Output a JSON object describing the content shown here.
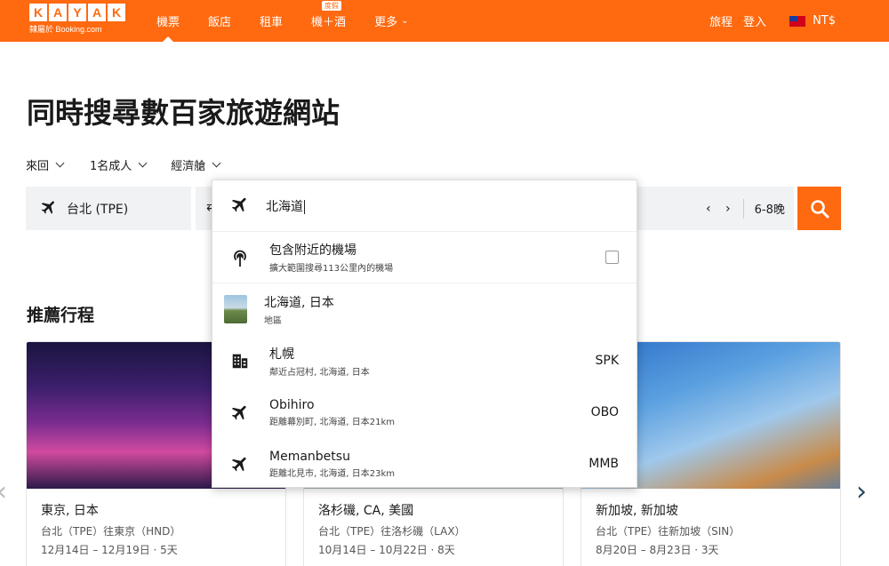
{
  "header": {
    "logo_letters": [
      "K",
      "A",
      "Y",
      "A",
      "K"
    ],
    "logo_sub": "隸屬於 Booking.com",
    "nav": [
      {
        "label": "機票",
        "active": true
      },
      {
        "label": "飯店",
        "active": false
      },
      {
        "label": "租車",
        "active": false
      },
      {
        "label": "機＋酒",
        "badge": "度假",
        "active": false
      },
      {
        "label": "更多",
        "active": false
      }
    ],
    "trips": "旅程",
    "login": "登入",
    "currency": "NT$"
  },
  "title": "同時搜尋數百家旅遊網站",
  "options": {
    "trip_type": "來回",
    "travelers": "1名成人",
    "cabin": "經濟艙"
  },
  "search": {
    "origin": "台北 (TPE)",
    "destination_value": "北海道",
    "date_arrows": "‹ ›",
    "nights": "6-8晚"
  },
  "dropdown": {
    "nearby_title": "包含附近的機場",
    "nearby_desc": "擴大範圍搜尋113公里內的機場",
    "results": [
      {
        "icon": "region-thumbnail",
        "name": "北海道, 日本",
        "desc": "地區",
        "code": ""
      },
      {
        "icon": "city-building-icon",
        "name": "札幌",
        "desc": "鄰近占冠村, 北海道, 日本",
        "code": "SPK"
      },
      {
        "icon": "airplane-icon",
        "name": "Obihiro",
        "desc": "距離幕別町, 北海道, 日本21km",
        "code": "OBO"
      },
      {
        "icon": "airplane-icon",
        "name": "Memanbetsu",
        "desc": "距離北見市, 北海道, 日本23km",
        "code": "MMB"
      }
    ]
  },
  "recommended": {
    "title": "推薦行程",
    "cards": [
      {
        "title": "東京, 日本",
        "route": "台北（TPE）往東京（HND）",
        "dates": "12月14日 – 12月19日 · 5天"
      },
      {
        "title": "洛杉磯, CA, 美國",
        "route": "台北（TPE）往洛杉磯（LAX）",
        "dates": "10月14日 – 10月22日 · 8天"
      },
      {
        "title": "新加坡, 新加坡",
        "route": "台北（TPE）往新加坡（SIN）",
        "dates": "8月20日 – 8月23日 · 3天"
      }
    ]
  },
  "colors": {
    "brand": "#ff690f",
    "search_bg": "#f1f2f4"
  }
}
